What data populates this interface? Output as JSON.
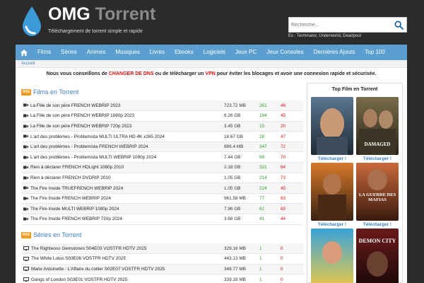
{
  "header": {
    "logo_part1": "OMG ",
    "logo_part2": "Torrent",
    "subtitle": "Téléchargement de torrent simple et rapide",
    "search_placeholder": "Recherche...",
    "search_hint": "Ex : Terminator, Underworld, Deadpool",
    "search_icon": "search-icon",
    "logo_icon": "water-drop-icon"
  },
  "nav": {
    "home_icon": "home-icon",
    "items": [
      "Films",
      "Séries",
      "Animes",
      "Musiques",
      "Livres",
      "Ebooks",
      "Logiciels",
      "Jeux PC",
      "Jeux Consoles",
      "Dernières Ajouts",
      "Top 100"
    ]
  },
  "breadcrumb": "Accueil",
  "notice": {
    "part1": "Nous vous conseillons de ",
    "link1": "CHANGER DE DNS",
    "part2": " ou de télécharger un ",
    "link2": "VPN",
    "part3": " pour éviter les blocages et avoir une connexion rapide et sécurisée."
  },
  "films": {
    "title": "Films en Torrent",
    "rss": "RSS",
    "icon": "film-camera-icon",
    "rows": [
      {
        "name": "La Fille de son père FRENCH WEBRIP 2023",
        "size": "723.72 MB",
        "seed": "261",
        "leech": "46"
      },
      {
        "name": "La Fille de son père FRENCH WEBRIP 1080p 2023",
        "size": "6.26 GB",
        "seed": "194",
        "leech": "45"
      },
      {
        "name": "La Fille de son père FRENCH WEBRIP 720p 2023",
        "size": "3.45 GB",
        "seed": "15",
        "leech": "20"
      },
      {
        "name": "L'art des problèmes - Problemista MULTI ULTRA HD 4K x265 2024",
        "size": "18.67 GB",
        "seed": "28",
        "leech": "47"
      },
      {
        "name": "L'art des problèmes - Problemista FRENCH WEBRIP 2024",
        "size": "886.4 MB",
        "seed": "347",
        "leech": "72"
      },
      {
        "name": "L'art des problèmes - Problemista MULTI WEBRIP 1080p 2024",
        "size": "7.44 GB",
        "seed": "99",
        "leech": "70"
      },
      {
        "name": "Rien à déclarer FRENCH HDLight 1080p 2010",
        "size": "2.18 GB",
        "seed": "321",
        "leech": "64"
      },
      {
        "name": "Rien à déclarer FRENCH DVDRIP 2010",
        "size": "1.05 GB",
        "seed": "214",
        "leech": "73"
      },
      {
        "name": "The Fire Inside TRUEFRENCH WEBRIP 2024",
        "size": "1.05 GB",
        "seed": "224",
        "leech": "45"
      },
      {
        "name": "The Fire Inside FRENCH WEBRIP 2024",
        "size": "961.58 MB",
        "seed": "77",
        "leech": "63"
      },
      {
        "name": "The Fire Inside MULTI WEBRIP 1080p 2024",
        "size": "7.96 GB",
        "seed": "62",
        "leech": "65"
      },
      {
        "name": "The Fire Inside FRENCH WEBRIP 720p 2024",
        "size": "3.68 GB",
        "seed": "41",
        "leech": "44"
      }
    ]
  },
  "series": {
    "title": "Séries en Torrent",
    "rss": "RSS",
    "icon": "tv-screen-icon",
    "rows": [
      {
        "name": "The Righteous Gemstones S04E03 VOSTFR HDTV 2025",
        "size": "329.16 MB",
        "seed": "1",
        "leech": "0"
      },
      {
        "name": "The White Lotus S03E06 VOSTFR HDTV 2025",
        "size": "443.13 MB",
        "seed": "1",
        "leech": "0"
      },
      {
        "name": "Marie Antoinette : L'Affaire du collier S02E07 VOSTFR HDTV 2025",
        "size": "348.77 MB",
        "seed": "1",
        "leech": "0"
      },
      {
        "name": "Gangs of London S03E01 VOSTFR HDTV 2025",
        "size": "339.18 MB",
        "seed": "1",
        "leech": "0"
      }
    ]
  },
  "sidebar": {
    "title": "Top Film en Torrent",
    "download_label": "Télécharger !",
    "posters": [
      {
        "text": ""
      },
      {
        "text": "DAMAGED"
      },
      {
        "text": ""
      },
      {
        "text": "LA GUERRE DES MAFIAS"
      },
      {
        "text": ""
      },
      {
        "text": "DEMON CITY"
      }
    ]
  }
}
